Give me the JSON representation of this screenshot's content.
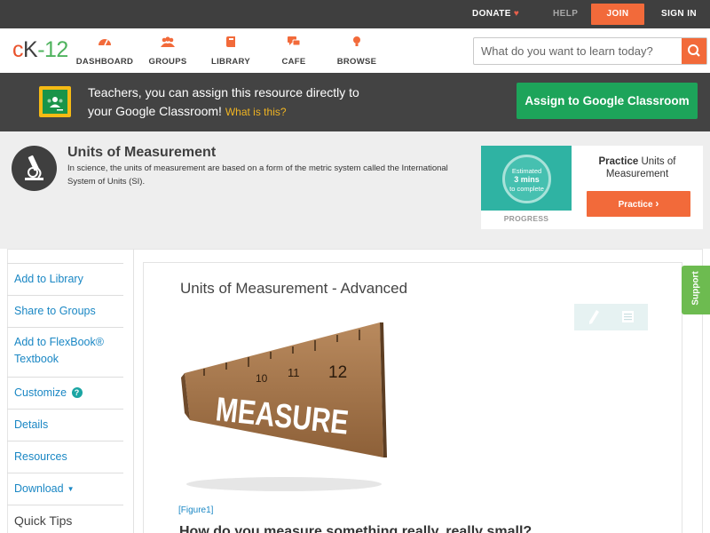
{
  "topbar": {
    "donate": "DONATE",
    "help": "HELP",
    "join": "JOIN",
    "sign_in": "SIGN IN"
  },
  "header": {
    "logo": {
      "c": "c",
      "k": "K",
      "dash": "-",
      "num": "12"
    },
    "nav": [
      {
        "label": "DASHBOARD",
        "icon": "dashboard-icon"
      },
      {
        "label": "GROUPS",
        "icon": "groups-icon"
      },
      {
        "label": "LIBRARY",
        "icon": "library-icon"
      },
      {
        "label": "CAFE",
        "icon": "cafe-icon"
      },
      {
        "label": "BROWSE",
        "icon": "browse-icon"
      }
    ],
    "search_placeholder": "What do you want to learn today?"
  },
  "google_banner": {
    "line1": "Teachers, you can assign this resource directly to",
    "line2": "your Google Classroom!",
    "what_link": "What is this?",
    "button": "Assign to Google Classroom"
  },
  "concept": {
    "title": "Units of Measurement",
    "description": "In science, the units of measurement are based on a form of the metric system called the International System of Units (SI).",
    "practice": {
      "estimate_1": "Estimated",
      "estimate_2": "3 mins",
      "estimate_3": "to complete",
      "progress_label": "PROGRESS",
      "title_bold": "Practice",
      "title_rest": "Units of Measurement",
      "button": "Practice"
    }
  },
  "sidebar": {
    "items": [
      {
        "label": "Add to Library"
      },
      {
        "label": "Share to Groups"
      },
      {
        "label": "Add to FlexBook®"
      },
      {
        "label": "Textbook"
      },
      {
        "label": "Customize"
      },
      {
        "label": "Details"
      },
      {
        "label": "Resources"
      },
      {
        "label": "Download"
      }
    ],
    "quick_tips": "Quick Tips"
  },
  "article": {
    "title": "Units of Measurement - Advanced",
    "figure_word": "MEASURE",
    "ruler_numbers": [
      "12",
      "11",
      "10"
    ],
    "figure_caption": "[Figure1]",
    "subheading": "How do you measure something really, really small?"
  },
  "support": "Support",
  "colors": {
    "accent_orange": "#f26a3a",
    "google_green": "#1da45a",
    "link_blue": "#1a87c4",
    "support_green": "#6dbb50"
  }
}
